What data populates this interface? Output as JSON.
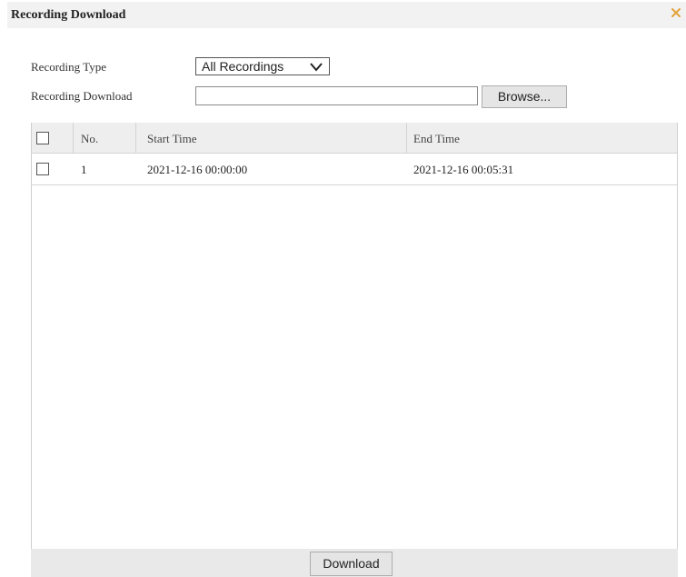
{
  "dialog": {
    "title": "Recording Download",
    "close_icon": "close-icon",
    "accent_color": "#e3a23a"
  },
  "form": {
    "recording_type_label": "Recording Type",
    "recording_type_value": "All Recordings",
    "recording_download_label": "Recording Download",
    "recording_download_value": "",
    "browse_label": "Browse..."
  },
  "table": {
    "columns": [
      "No.",
      "Start Time",
      "End Time"
    ],
    "rows": [
      {
        "no": "1",
        "start": "2021-12-16 00:00:00",
        "end": "2021-12-16 00:05:31"
      }
    ]
  },
  "footer": {
    "download_label": "Download"
  }
}
